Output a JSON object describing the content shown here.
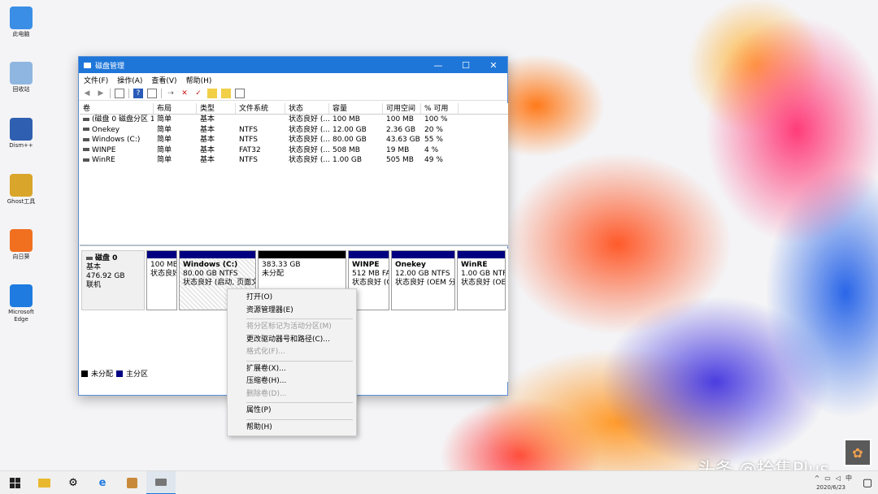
{
  "desktop": {
    "icons": [
      {
        "label": "此电脑",
        "color": "#3a8ee6",
        "icon": "computer-icon"
      },
      {
        "label": "回收站",
        "color": "#8fb6e0",
        "icon": "recycle-bin-icon"
      },
      {
        "label": "Dism++",
        "color": "#2f5fb0",
        "icon": "dism-icon"
      },
      {
        "label": "Ghost工具",
        "color": "#d9a52a",
        "icon": "tool-icon"
      },
      {
        "label": "向日葵",
        "color": "#f07020",
        "icon": "remote-icon"
      },
      {
        "label": "Microsoft Edge",
        "color": "#1f7be0",
        "icon": "edge-icon"
      }
    ]
  },
  "window": {
    "title": "磁盘管理",
    "menu": [
      "文件(F)",
      "操作(A)",
      "查看(V)",
      "帮助(H)"
    ],
    "controls": {
      "minimize": "—",
      "maximize": "☐",
      "close": "✕"
    }
  },
  "volumes": {
    "headers": [
      "卷",
      "布局",
      "类型",
      "文件系统",
      "状态",
      "容量",
      "可用空间",
      "% 可用"
    ],
    "rows": [
      [
        "(磁盘 0 磁盘分区 1)",
        "简单",
        "基本",
        "",
        "状态良好 (...",
        "100 MB",
        "100 MB",
        "100 %"
      ],
      [
        "Onekey",
        "简单",
        "基本",
        "NTFS",
        "状态良好 (...",
        "12.00 GB",
        "2.36 GB",
        "20 %"
      ],
      [
        "Windows (C:)",
        "简单",
        "基本",
        "NTFS",
        "状态良好 (...",
        "80.00 GB",
        "43.63 GB",
        "55 %"
      ],
      [
        "WINPE",
        "简单",
        "基本",
        "FAT32",
        "状态良好 (...",
        "508 MB",
        "19 MB",
        "4 %"
      ],
      [
        "WinRE",
        "简单",
        "基本",
        "NTFS",
        "状态良好 (...",
        "1.00 GB",
        "505 MB",
        "49 %"
      ]
    ]
  },
  "disk": {
    "name": "磁盘 0",
    "type": "基本",
    "size": "476.92 GB",
    "status": "联机",
    "partitions": [
      {
        "name": "",
        "line1": "100 MB",
        "line2": "状态良好"
      },
      {
        "name": "Windows (C:)",
        "line1": "80.00 GB NTFS",
        "line2": "状态良好 (启动, 页面文"
      },
      {
        "name": "",
        "line1": "383.33 GB",
        "line2": "未分配"
      },
      {
        "name": "WINPE",
        "line1": "512 MB FAT32",
        "line2": "状态良好 (C"
      },
      {
        "name": "Onekey",
        "line1": "12.00 GB NTFS",
        "line2": "状态良好 (OEM 分"
      },
      {
        "name": "WinRE",
        "line1": "1.00 GB NTFS",
        "line2": "状态良好 (OE"
      }
    ],
    "legend": {
      "unallocated": "未分配",
      "primary": "主分区"
    }
  },
  "context_menu": {
    "items": [
      {
        "label": "打开(O)",
        "enabled": true
      },
      {
        "label": "资源管理器(E)",
        "enabled": true
      },
      {
        "label": "将分区标记为活动分区(M)",
        "enabled": false
      },
      {
        "label": "更改驱动器号和路径(C)...",
        "enabled": true
      },
      {
        "label": "格式化(F)...",
        "enabled": false
      },
      {
        "label": "扩展卷(X)...",
        "enabled": true
      },
      {
        "label": "压缩卷(H)...",
        "enabled": true
      },
      {
        "label": "删除卷(D)...",
        "enabled": false
      },
      {
        "label": "属性(P)",
        "enabled": true
      },
      {
        "label": "帮助(H)",
        "enabled": true
      }
    ]
  },
  "taskbar": {
    "ime": "中",
    "date": "2020/6/23"
  },
  "watermark": "头条 @拾集Plus",
  "colors": {
    "titlebar": "#1e76d9",
    "primary_partition": "#000080",
    "unallocated": "#000000"
  }
}
